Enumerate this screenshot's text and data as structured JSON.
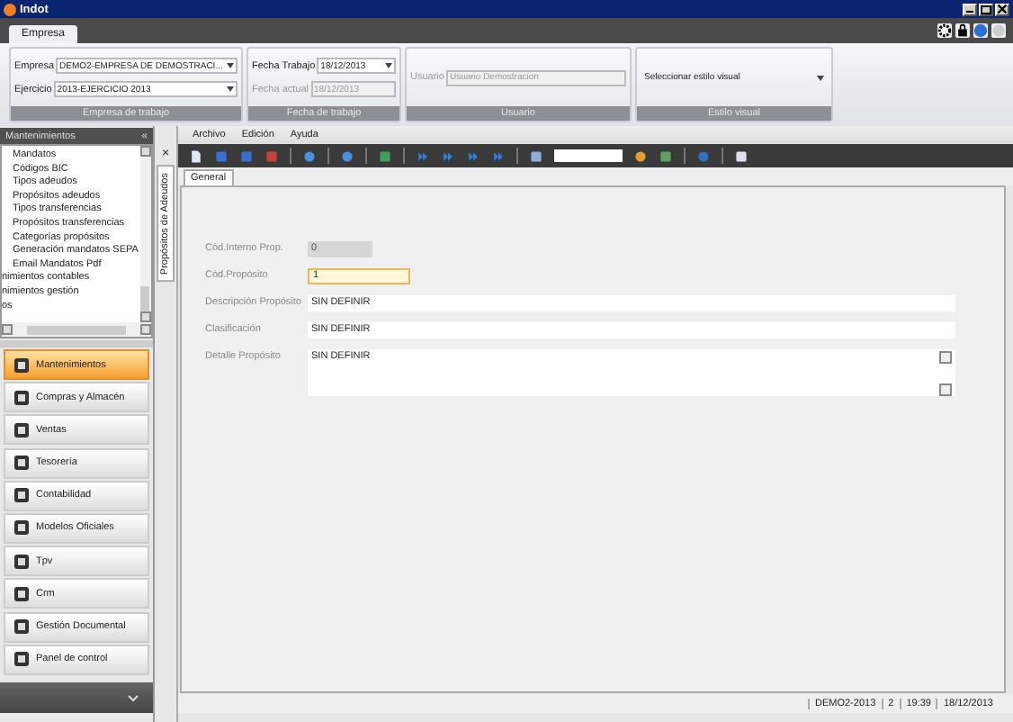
{
  "window": {
    "title": "Indot"
  },
  "ribbon_tabs": [
    {
      "label": "Empresa",
      "selected": true
    }
  ],
  "ribbon_groups": [
    {
      "caption": "Empresa de trabajo",
      "fields": [
        {
          "label": "Empresa",
          "value": "DEMO2-EMPRESA DE DEMOSTRACI...",
          "kind": "dropdown",
          "disabled": false
        },
        {
          "label": "Ejercicio",
          "value": "2013-EJERCICIO 2013",
          "kind": "dropdown",
          "disabled": false
        }
      ]
    },
    {
      "caption": "Fecha de trabajo",
      "fields": [
        {
          "label": "Fecha Trabajo",
          "value": "18/12/2013",
          "kind": "dropdown",
          "disabled": false
        },
        {
          "label": "Fecha actual",
          "value": "18/12/2013",
          "kind": "text",
          "disabled": true
        }
      ]
    },
    {
      "caption": "Usuario",
      "fields": [
        {
          "label": "Usuario",
          "value": "Usuario Demostracion",
          "kind": "text",
          "disabled": true
        }
      ]
    },
    {
      "caption": "Estilo visual",
      "fields": [
        {
          "value": "Seleccionar estilo visual",
          "kind": "dropdown",
          "disabled": false
        }
      ]
    }
  ],
  "sidebar": {
    "title": "Mantenimientos",
    "collapse_glyph": "«",
    "tree": {
      "branch_items": [
        "Mandatos",
        "Códigos BIC",
        "Tipos adeudos",
        "Propósitos adeudos",
        "Tipos transferencias",
        "Propósitos transferencias",
        "Categorías propósitos",
        "Generación mandatos SEPA",
        "Email Mandatos Pdf"
      ],
      "items": [
        "nimientos contables",
        "nimientos gestión",
        "os"
      ]
    },
    "modules": [
      {
        "label": "Mantenimientos",
        "selected": true
      },
      {
        "label": "Compras y Almacén",
        "selected": false
      },
      {
        "label": "Ventas",
        "selected": false
      },
      {
        "label": "Tesorería",
        "selected": false
      },
      {
        "label": "Contabilidad",
        "selected": false
      },
      {
        "label": "Modelos Oficiales",
        "selected": false
      },
      {
        "label": "Tpv",
        "selected": false
      },
      {
        "label": "Crm",
        "selected": false
      },
      {
        "label": "Gestión Documental",
        "selected": false
      },
      {
        "label": "Panel de control",
        "selected": false
      }
    ]
  },
  "side_tab": {
    "label": "Propósitos de Adeudos",
    "close_glyph": "×"
  },
  "menu": [
    "Archivo",
    "Edición",
    "Ayuda"
  ],
  "form_tabs": [
    {
      "label": "General",
      "selected": true
    }
  ],
  "form": [
    {
      "label": "Cód.Interno Prop.",
      "value": "0",
      "kind": "readonly"
    },
    {
      "label": "Cód.Propósito",
      "value": "1",
      "kind": "focused"
    },
    {
      "label": "Descripción Propósito",
      "value": "SIN DEFINIR",
      "kind": "text"
    },
    {
      "label": "Clasificación",
      "value": "SIN DEFINIR",
      "kind": "text"
    },
    {
      "label": "Detalle Propósito",
      "value": "SIN DEFINIR",
      "kind": "memo"
    }
  ],
  "status_bar": [
    "DEMO2-2013",
    "2",
    "19:39",
    "18/12/2013"
  ]
}
